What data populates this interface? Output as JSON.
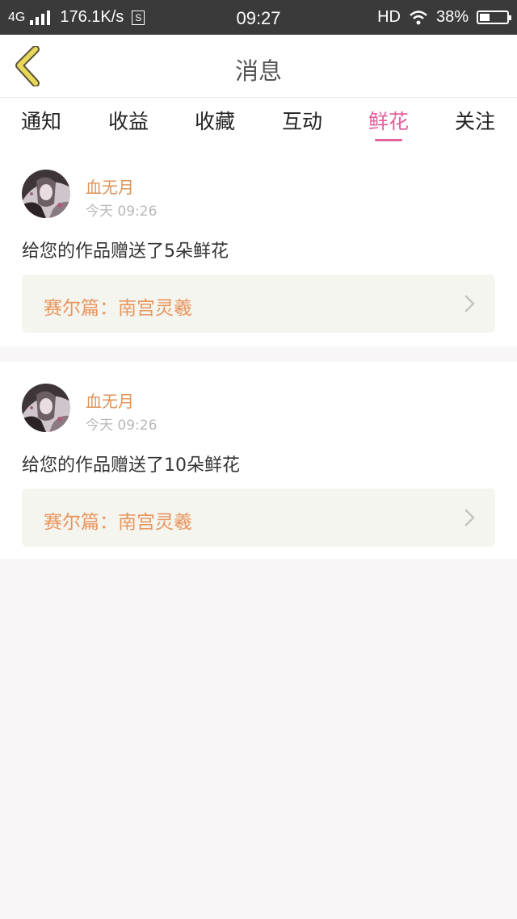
{
  "status_bar": {
    "network": "4G",
    "speed": "176.1K/s",
    "sim_icon_label": "S",
    "time": "09:27",
    "hd": "HD",
    "battery": "38%",
    "battery_level": 0.38
  },
  "header": {
    "title": "消息"
  },
  "tabs": [
    {
      "label": "通知"
    },
    {
      "label": "收益"
    },
    {
      "label": "收藏"
    },
    {
      "label": "互动"
    },
    {
      "label": "鲜花",
      "active": true
    },
    {
      "label": "关注"
    }
  ],
  "messages": [
    {
      "username": "血无月",
      "time": "今天 09:26",
      "text": "给您的作品赠送了5朵鲜花",
      "work_title": "赛尔篇：南宫灵羲"
    },
    {
      "username": "血无月",
      "time": "今天 09:26",
      "text": "给您的作品赠送了10朵鲜花",
      "work_title": "赛尔篇：南宫灵羲"
    }
  ],
  "colors": {
    "accent": "#e3619d",
    "username": "#e0945b",
    "work_title": "#e8955e",
    "back_icon": "#e8d85a"
  }
}
